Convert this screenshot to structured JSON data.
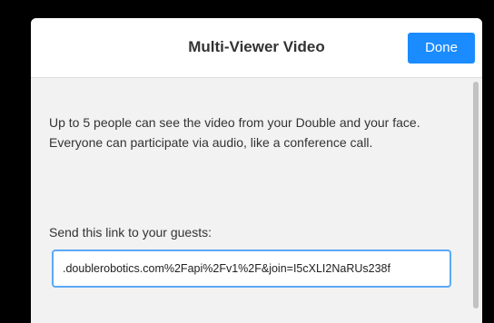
{
  "dialog": {
    "title": "Multi-Viewer Video",
    "done_label": "Done",
    "description": "Up to 5 people can see the video from your Double and your face. Everyone can participate via audio, like a conference call.",
    "link_label": "Send this link to your guests:",
    "link_value": ".doublerobotics.com%2Fapi%2Fv1%2F&join=I5cXLI2NaRUs238f"
  },
  "colors": {
    "accent": "#1a8cff",
    "background": "#000000",
    "panel": "#f2f2f2"
  }
}
